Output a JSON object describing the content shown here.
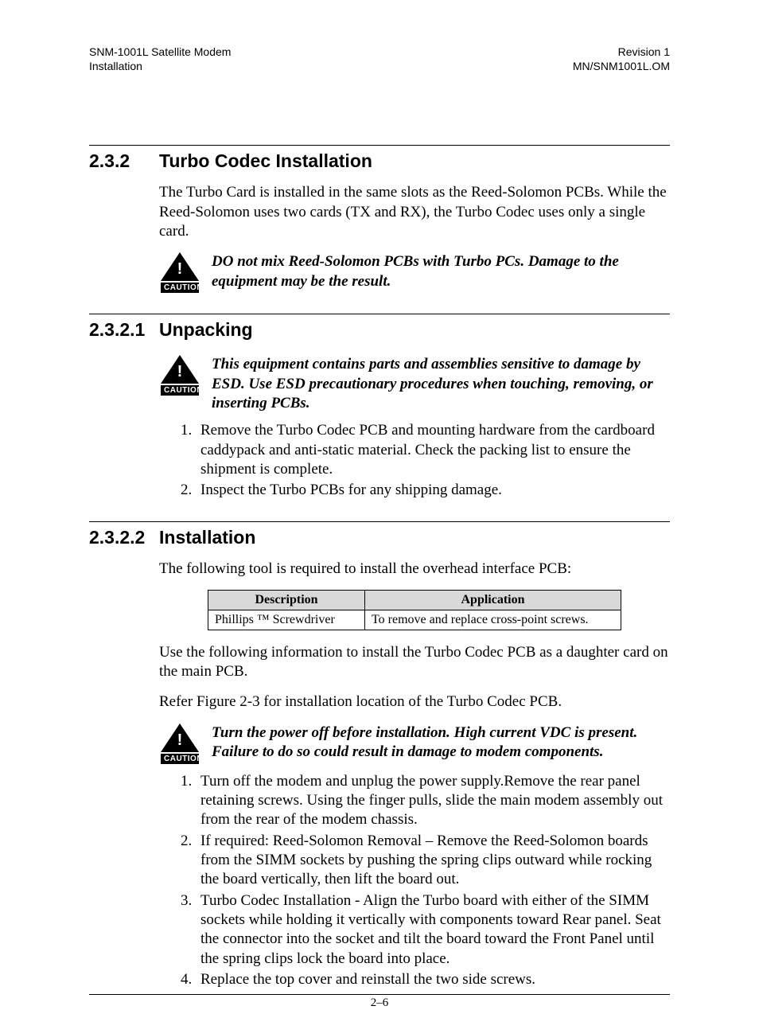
{
  "header": {
    "left1": "SNM-1001L Satellite Modem",
    "left2": "Installation",
    "right1": "Revision 1",
    "right2": "MN/SNM1001L.OM"
  },
  "caution_label": "CAUTION",
  "sec232": {
    "num": "2.3.2",
    "title": "Turbo Codec Installation",
    "p1": "The Turbo Card is installed in the same slots as the Reed-Solomon PCBs. While the Reed-Solomon uses two cards (TX and RX), the Turbo Codec uses only a single card.",
    "caution": "DO not mix Reed-Solomon PCBs with Turbo PCs. Damage to the equipment may be the result."
  },
  "sec2321": {
    "num": "2.3.2.1",
    "title": "Unpacking",
    "caution": "This equipment contains parts and assemblies sensitive to damage by ESD. Use ESD precautionary procedures when touching, removing, or inserting PCBs.",
    "steps": [
      "Remove the Turbo Codec PCB and mounting hardware from the cardboard caddypack and anti-static material.  Check the packing list to ensure the shipment is complete.",
      "Inspect the Turbo PCBs for any shipping damage."
    ]
  },
  "sec2322": {
    "num": "2.3.2.2",
    "title": "Installation",
    "p1": "The following tool is required to install the overhead interface PCB:",
    "table": {
      "headers": [
        "Description",
        "Application"
      ],
      "row": [
        "Phillips ™ Screwdriver",
        "To remove and replace cross-point screws."
      ]
    },
    "p2": "Use the following information to install the Turbo Codec PCB as a daughter card on the main PCB.",
    "p3": "Refer Figure 2-3 for installation location of the Turbo Codec PCB.",
    "caution": "Turn the power off before installation. High current VDC is present. Failure to do so could result in damage to modem components.",
    "steps": [
      "Turn off the modem and unplug the power supply.Remove the rear panel retaining screws. Using the finger pulls, slide the main modem assembly out from the rear of the modem chassis.",
      "If required: Reed-Solomon Removal – Remove the Reed-Solomon boards from the SIMM sockets by pushing the spring clips outward while rocking the board vertically, then lift the board out.",
      "Turbo Codec Installation - Align the Turbo board with either of the SIMM sockets while holding it vertically with components toward Rear panel. Seat the connector into the socket and tilt the board toward the Front Panel until the spring clips lock the board into place.",
      "Replace the top cover and reinstall the two side screws."
    ]
  },
  "page_num": "2–6"
}
